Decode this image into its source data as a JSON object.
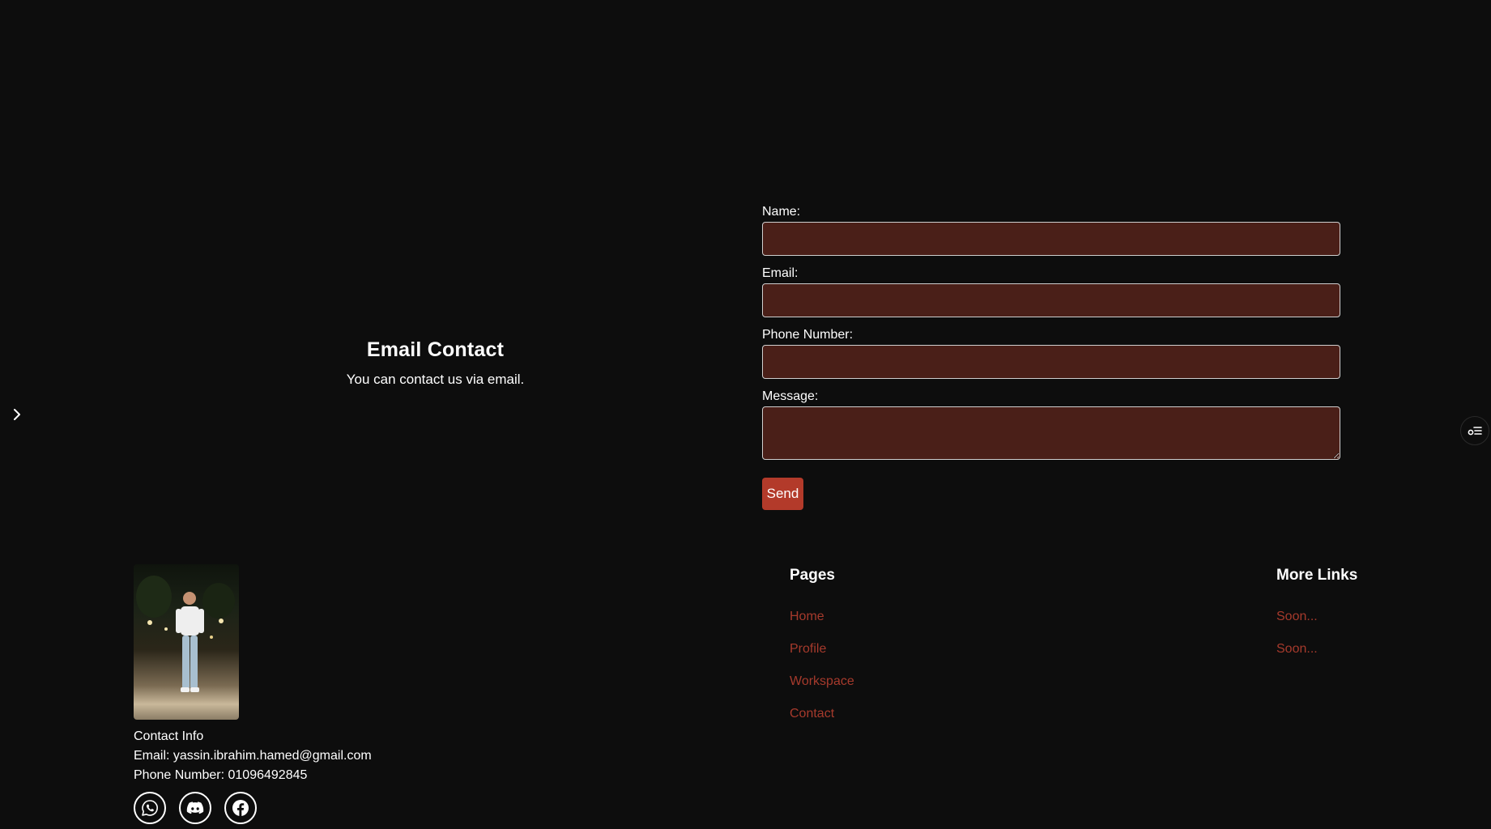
{
  "hero": {
    "title": "Email Contact",
    "subtitle": "You can contact us via email."
  },
  "form": {
    "name_label": "Name:",
    "email_label": "Email:",
    "phone_label": "Phone Number:",
    "message_label": "Message:",
    "name_value": "",
    "email_value": "",
    "phone_value": "",
    "message_value": "",
    "send_label": "Send"
  },
  "footer": {
    "contact_title": "Contact Info",
    "email_line": "Email: yassin.ibrahim.hamed@gmail.com",
    "phone_line": "Phone Number: 01096492845",
    "socials": [
      "whatsapp-icon",
      "discord-icon",
      "facebook-icon"
    ],
    "pages": {
      "title": "Pages",
      "links": [
        "Home",
        "Profile",
        "Workspace",
        "Contact"
      ]
    },
    "more_links": {
      "title": "More Links",
      "links": [
        "Soon...",
        "Soon..."
      ]
    }
  },
  "colors": {
    "background": "#0d0d0d",
    "input_bg": "#4a1f18",
    "accent": "#b33a2a",
    "link": "#a63a2c"
  }
}
